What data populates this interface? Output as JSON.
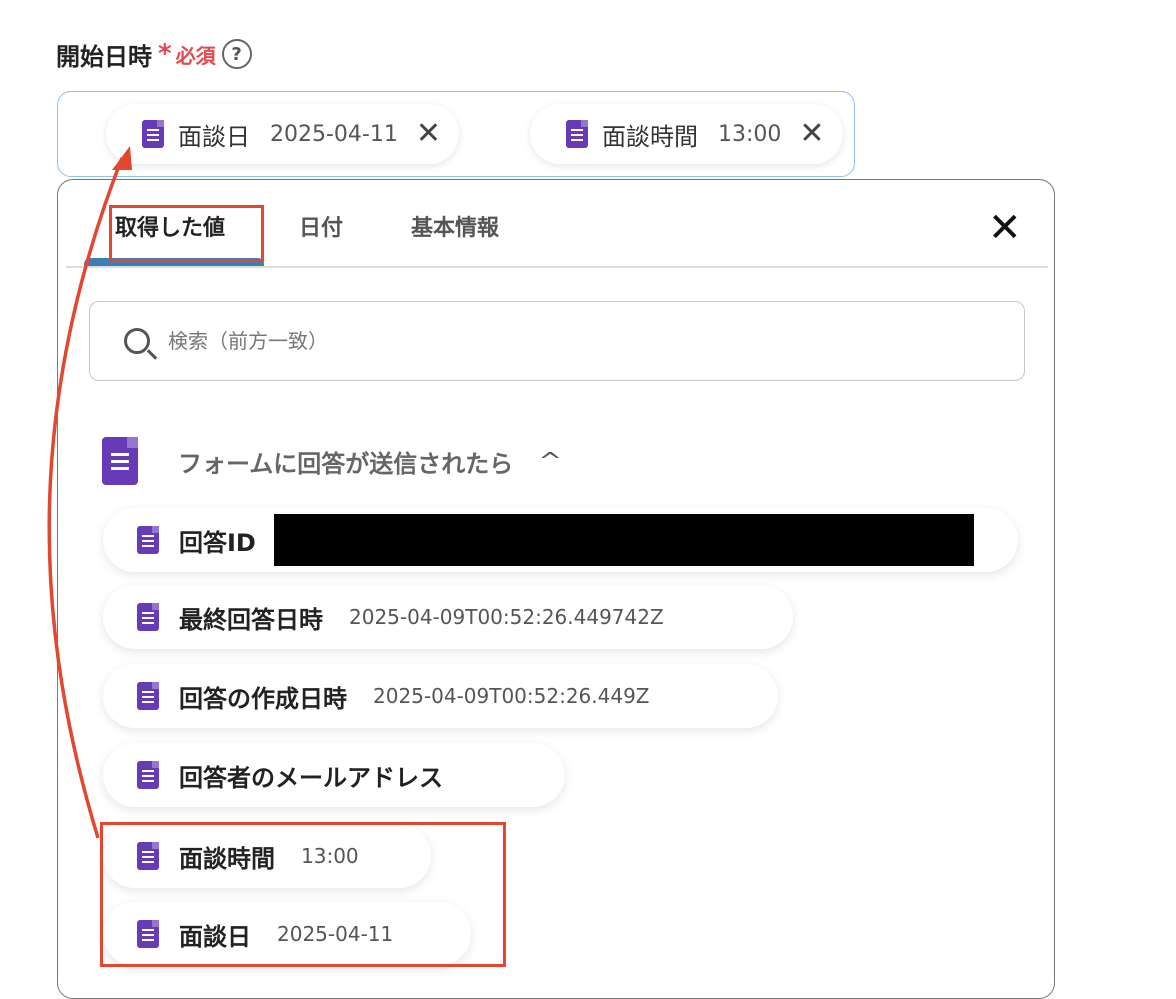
{
  "field": {
    "label": "開始日時",
    "required_mark": "*",
    "required_text": "必須",
    "help_icon": "?"
  },
  "selected_tokens": [
    {
      "name": "面談日",
      "value": "2025-04-11",
      "close": "✕",
      "icon": "google-forms-icon"
    },
    {
      "name": "面談時間",
      "value": "13:00",
      "close": "✕",
      "icon": "google-forms-icon"
    }
  ],
  "panel": {
    "tabs": [
      "取得した値",
      "日付",
      "基本情報"
    ],
    "active_tab": "取得した値",
    "close": "✕",
    "search_placeholder": "検索（前方一致）",
    "group": {
      "title": "フォームに回答が送信されたら",
      "chevron": "^",
      "icon": "google-forms-icon"
    },
    "items": [
      {
        "name": "回答ID",
        "value": ""
      },
      {
        "name": "最終回答日時",
        "value": "2025-04-09T00:52:26.449742Z"
      },
      {
        "name": "回答の作成日時",
        "value": "2025-04-09T00:52:26.449Z"
      },
      {
        "name": "回答者のメールアドレス",
        "value": ""
      },
      {
        "name": "面談時間",
        "value": "13:00"
      },
      {
        "name": "面談日",
        "value": "2025-04-11"
      }
    ]
  },
  "colors": {
    "accent_red": "#e4472f",
    "required_red": "#e5484d",
    "forms_purple": "#673ab7",
    "input_border": "#8fc0ee",
    "tab_underline": "#3d7fb0"
  }
}
